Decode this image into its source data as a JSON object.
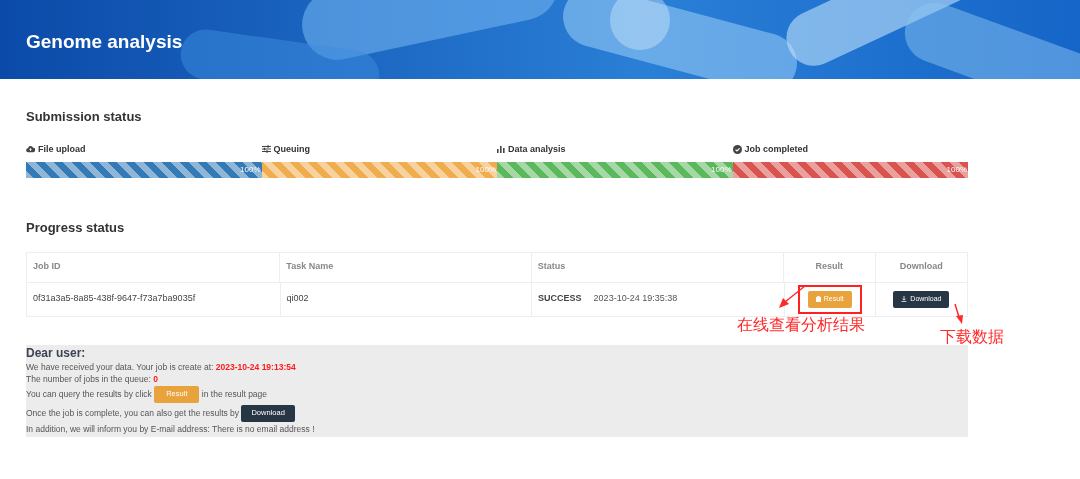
{
  "header": {
    "title": "Genome analysis"
  },
  "submission": {
    "title": "Submission status",
    "steps": [
      {
        "kind": "upload",
        "label": "File upload",
        "level": 1,
        "reading": "100%",
        "color": "#337ab7"
      },
      {
        "kind": "queue",
        "label": "Queuing",
        "level": 1,
        "reading": "100%",
        "color": "#f0ad4e"
      },
      {
        "kind": "analysis",
        "label": "Data analysis",
        "level": 1,
        "reading": "100%",
        "color": "#5cb85c"
      },
      {
        "kind": "done",
        "label": "Job completed",
        "level": 1,
        "reading": "100%",
        "color": "#d9534f"
      }
    ]
  },
  "progress": {
    "title": "Progress status",
    "columns": [
      "Job ID",
      "Task Name",
      "Status",
      "Result",
      "Download"
    ],
    "rows": [
      {
        "job_id": "0f31a3a5-8a85-438f-9647-f73a7ba9035f",
        "task_name": "qi002",
        "status": "SUCCESS",
        "time": "2023-10-24 19:35:38",
        "result_button": "Result",
        "download_button": "Download"
      }
    ]
  },
  "notice": {
    "title": "Dear user:",
    "lines": [
      [
        {
          "kind": "text",
          "text": "We have received your data. Your job is create at: "
        },
        {
          "kind": "value",
          "text": "2023-10-24 19:13:54"
        }
      ],
      [
        {
          "kind": "text",
          "text": "The number of jobs in the queue: "
        },
        {
          "kind": "value",
          "text": "0"
        }
      ],
      [
        {
          "kind": "text",
          "text": "You can query the results by click "
        },
        {
          "kind": "result",
          "text": "Result"
        },
        {
          "kind": "text",
          "text": " in the result page"
        }
      ],
      [
        {
          "kind": "text",
          "text": "Once the job is complete, you can also get the results by "
        },
        {
          "kind": "download",
          "text": "Download"
        }
      ],
      [
        {
          "kind": "text",
          "text": "In addition, we will inform you by E-mail address: There is no email address !"
        }
      ]
    ]
  },
  "annotations": [
    {
      "kind": "result",
      "text": "在线查看分析结果"
    },
    {
      "kind": "download",
      "text": "下载数据"
    }
  ]
}
